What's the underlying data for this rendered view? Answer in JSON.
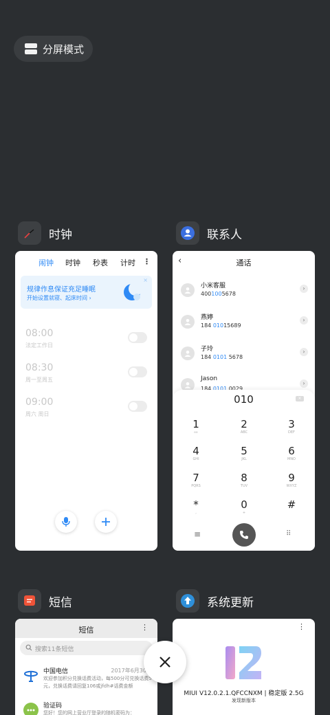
{
  "split_screen": {
    "label": "分屏模式"
  },
  "close": {
    "icon": "close-icon"
  },
  "apps": {
    "clock": {
      "name": "时钟",
      "tabs": [
        "闹钟",
        "时钟",
        "秒表",
        "计时"
      ],
      "active_tab": "闹钟",
      "promo": {
        "title": "规律作息保证充足睡眠",
        "subtitle": "开始设置就寝、起床时间 ›"
      },
      "alarms": [
        {
          "time": "08:00",
          "repeat": "法定工作日",
          "enabled": false
        },
        {
          "time": "08:30",
          "repeat": "周一至周五",
          "enabled": false
        },
        {
          "time": "09:00",
          "repeat": "周六 周日",
          "enabled": false
        }
      ],
      "accent": "#2f8af5"
    },
    "contacts": {
      "name": "联系人",
      "title": "通话",
      "list": [
        {
          "name": "小米客服",
          "num_pre": "400",
          "num_hl": "100",
          "num_post": "5678"
        },
        {
          "name": "燕婷",
          "num_pre": "184 ",
          "num_hl": "010",
          "num_post": "15689"
        },
        {
          "name": "子玲",
          "num_pre": "184 ",
          "num_hl": "0101",
          "num_post": " 5678"
        },
        {
          "name": "Jason",
          "num_pre": "184 ",
          "num_hl": "0101",
          "num_post": " 0029"
        }
      ],
      "dialed": "010",
      "keys": [
        {
          "d": "1",
          "l": "ဓဓ"
        },
        {
          "d": "2",
          "l": "ABC"
        },
        {
          "d": "3",
          "l": "DEF"
        },
        {
          "d": "4",
          "l": "GHI"
        },
        {
          "d": "5",
          "l": "JKL"
        },
        {
          "d": "6",
          "l": "MNO"
        },
        {
          "d": "7",
          "l": "PQRS"
        },
        {
          "d": "8",
          "l": "TUV"
        },
        {
          "d": "9",
          "l": "WXYZ"
        },
        {
          "d": "*",
          "l": ","
        },
        {
          "d": "0",
          "l": "+"
        },
        {
          "d": "#",
          "l": ""
        }
      ]
    },
    "sms": {
      "name": "短信",
      "title": "短信",
      "search_placeholder": "搜索11条短信",
      "messages": [
        {
          "name": "中国电信",
          "time": "2017年6月30日",
          "preview": "欢迎参加积分兑换话费活动，每500分可兑换话费5元，兑换话费请回复106或jfdh#话费金额"
        },
        {
          "name": "验证码",
          "time": "",
          "preview": "您好！您的网上营业厅登录的随机密码为："
        }
      ]
    },
    "update": {
      "name": "系统更新",
      "version": "MIUI V12.0.2.1.QFCCNXM | 稳定版 2.5G",
      "status": "发现新版本"
    }
  }
}
